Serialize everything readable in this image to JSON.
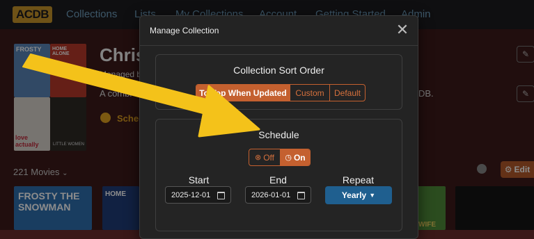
{
  "nav": {
    "logo": "ACDB",
    "items": [
      "Collections",
      "Lists",
      "My Collections",
      "Account",
      "Getting Started",
      "Admin"
    ]
  },
  "collection": {
    "title": "Chris",
    "managed_prefix": "Managed b",
    "description_start": "A combi",
    "description_end": "DB.",
    "schedule_label": "Sched",
    "movies_count": "221 Movies",
    "edit_label": "Edit",
    "posters": [
      {
        "title": "FROSTY",
        "color": "#5a86b8"
      },
      {
        "title": "HOME ALONE",
        "color": "#b83a2a"
      },
      {
        "title": "love actually",
        "color": "#d9d4cc"
      },
      {
        "title": "LITTLE WOMEN",
        "color": "#2e2a26"
      }
    ],
    "bottom_posters": [
      {
        "title": "FROSTY THE SNOWMAN",
        "color": "#2f6fb0"
      },
      {
        "title": "HOME",
        "color": "#1f3c78"
      },
      {
        "title": "WIFE",
        "color": "#4f8a3a"
      },
      {
        "title": "",
        "color": "#151515"
      }
    ]
  },
  "modal": {
    "title": "Manage Collection",
    "close_icon": "close-icon",
    "sort": {
      "heading": "Collection Sort Order",
      "options": [
        "To Top When Updated",
        "Custom",
        "Default"
      ],
      "selected": "To Top When Updated"
    },
    "schedule": {
      "heading": "Schedule",
      "off_label": "Off",
      "on_label": "On",
      "selected": "On",
      "start_label": "Start",
      "start_value": "2025-12-01",
      "end_label": "End",
      "end_value": "2026-01-01",
      "repeat_label": "Repeat",
      "repeat_value": "Yearly"
    }
  },
  "colors": {
    "accent": "#c4602f",
    "repeat_button": "#1f5f8f",
    "arrow": "#f4c21a",
    "page_bg": "#3d1a1a"
  }
}
